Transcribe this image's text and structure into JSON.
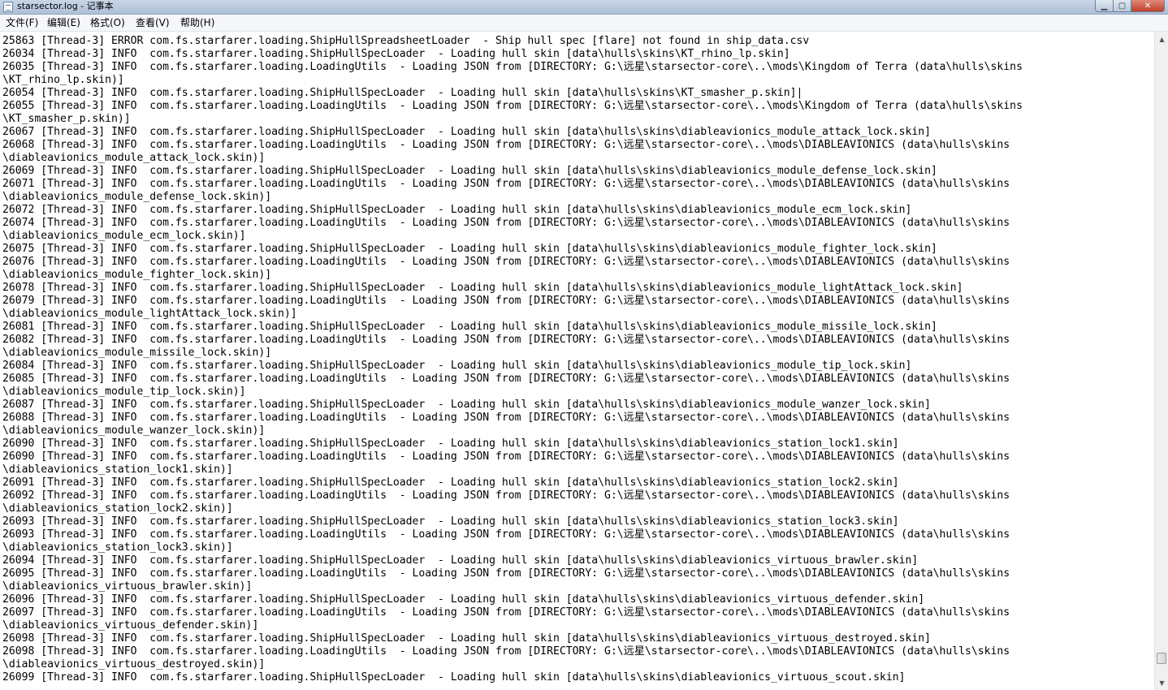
{
  "window": {
    "title": "starsector.log - 记事本",
    "controls": {
      "minimize": "▁",
      "maximize": "▢",
      "close": "✕"
    }
  },
  "menu": [
    "文件(F)",
    "编辑(E)",
    "格式(O)",
    "查看(V)",
    "帮助(H)"
  ],
  "scrollbar": {
    "position": 0.98,
    "up": "▲",
    "down": "▼"
  },
  "log_lines": [
    "25863 [Thread-3] ERROR com.fs.starfarer.loading.ShipHullSpreadsheetLoader  - Ship hull spec [flare] not found in ship_data.csv",
    "26034 [Thread-3] INFO  com.fs.starfarer.loading.ShipHullSpecLoader  - Loading hull skin [data\\hulls\\skins\\KT_rhino_lp.skin]",
    "26035 [Thread-3] INFO  com.fs.starfarer.loading.LoadingUtils  - Loading JSON from [DIRECTORY: G:\\远星\\starsector-core\\..\\mods\\Kingdom of Terra (data\\hulls\\skins",
    "\\KT_rhino_lp.skin)]",
    "26054 [Thread-3] INFO  com.fs.starfarer.loading.ShipHullSpecLoader  - Loading hull skin [data\\hulls\\skins\\KT_smasher_p.skin]|",
    "26055 [Thread-3] INFO  com.fs.starfarer.loading.LoadingUtils  - Loading JSON from [DIRECTORY: G:\\远星\\starsector-core\\..\\mods\\Kingdom of Terra (data\\hulls\\skins",
    "\\KT_smasher_p.skin)]",
    "26067 [Thread-3] INFO  com.fs.starfarer.loading.ShipHullSpecLoader  - Loading hull skin [data\\hulls\\skins\\diableavionics_module_attack_lock.skin]",
    "26068 [Thread-3] INFO  com.fs.starfarer.loading.LoadingUtils  - Loading JSON from [DIRECTORY: G:\\远星\\starsector-core\\..\\mods\\DIABLEAVIONICS (data\\hulls\\skins",
    "\\diableavionics_module_attack_lock.skin)]",
    "26069 [Thread-3] INFO  com.fs.starfarer.loading.ShipHullSpecLoader  - Loading hull skin [data\\hulls\\skins\\diableavionics_module_defense_lock.skin]",
    "26071 [Thread-3] INFO  com.fs.starfarer.loading.LoadingUtils  - Loading JSON from [DIRECTORY: G:\\远星\\starsector-core\\..\\mods\\DIABLEAVIONICS (data\\hulls\\skins",
    "\\diableavionics_module_defense_lock.skin)]",
    "26072 [Thread-3] INFO  com.fs.starfarer.loading.ShipHullSpecLoader  - Loading hull skin [data\\hulls\\skins\\diableavionics_module_ecm_lock.skin]",
    "26074 [Thread-3] INFO  com.fs.starfarer.loading.LoadingUtils  - Loading JSON from [DIRECTORY: G:\\远星\\starsector-core\\..\\mods\\DIABLEAVIONICS (data\\hulls\\skins",
    "\\diableavionics_module_ecm_lock.skin)]",
    "26075 [Thread-3] INFO  com.fs.starfarer.loading.ShipHullSpecLoader  - Loading hull skin [data\\hulls\\skins\\diableavionics_module_fighter_lock.skin]",
    "26076 [Thread-3] INFO  com.fs.starfarer.loading.LoadingUtils  - Loading JSON from [DIRECTORY: G:\\远星\\starsector-core\\..\\mods\\DIABLEAVIONICS (data\\hulls\\skins",
    "\\diableavionics_module_fighter_lock.skin)]",
    "26078 [Thread-3] INFO  com.fs.starfarer.loading.ShipHullSpecLoader  - Loading hull skin [data\\hulls\\skins\\diableavionics_module_lightAttack_lock.skin]",
    "26079 [Thread-3] INFO  com.fs.starfarer.loading.LoadingUtils  - Loading JSON from [DIRECTORY: G:\\远星\\starsector-core\\..\\mods\\DIABLEAVIONICS (data\\hulls\\skins",
    "\\diableavionics_module_lightAttack_lock.skin)]",
    "26081 [Thread-3] INFO  com.fs.starfarer.loading.ShipHullSpecLoader  - Loading hull skin [data\\hulls\\skins\\diableavionics_module_missile_lock.skin]",
    "26082 [Thread-3] INFO  com.fs.starfarer.loading.LoadingUtils  - Loading JSON from [DIRECTORY: G:\\远星\\starsector-core\\..\\mods\\DIABLEAVIONICS (data\\hulls\\skins",
    "\\diableavionics_module_missile_lock.skin)]",
    "26084 [Thread-3] INFO  com.fs.starfarer.loading.ShipHullSpecLoader  - Loading hull skin [data\\hulls\\skins\\diableavionics_module_tip_lock.skin]",
    "26085 [Thread-3] INFO  com.fs.starfarer.loading.LoadingUtils  - Loading JSON from [DIRECTORY: G:\\远星\\starsector-core\\..\\mods\\DIABLEAVIONICS (data\\hulls\\skins",
    "\\diableavionics_module_tip_lock.skin)]",
    "26087 [Thread-3] INFO  com.fs.starfarer.loading.ShipHullSpecLoader  - Loading hull skin [data\\hulls\\skins\\diableavionics_module_wanzer_lock.skin]",
    "26088 [Thread-3] INFO  com.fs.starfarer.loading.LoadingUtils  - Loading JSON from [DIRECTORY: G:\\远星\\starsector-core\\..\\mods\\DIABLEAVIONICS (data\\hulls\\skins",
    "\\diableavionics_module_wanzer_lock.skin)]",
    "26090 [Thread-3] INFO  com.fs.starfarer.loading.ShipHullSpecLoader  - Loading hull skin [data\\hulls\\skins\\diableavionics_station_lock1.skin]",
    "26090 [Thread-3] INFO  com.fs.starfarer.loading.LoadingUtils  - Loading JSON from [DIRECTORY: G:\\远星\\starsector-core\\..\\mods\\DIABLEAVIONICS (data\\hulls\\skins",
    "\\diableavionics_station_lock1.skin)]",
    "26091 [Thread-3] INFO  com.fs.starfarer.loading.ShipHullSpecLoader  - Loading hull skin [data\\hulls\\skins\\diableavionics_station_lock2.skin]",
    "26092 [Thread-3] INFO  com.fs.starfarer.loading.LoadingUtils  - Loading JSON from [DIRECTORY: G:\\远星\\starsector-core\\..\\mods\\DIABLEAVIONICS (data\\hulls\\skins",
    "\\diableavionics_station_lock2.skin)]",
    "26093 [Thread-3] INFO  com.fs.starfarer.loading.ShipHullSpecLoader  - Loading hull skin [data\\hulls\\skins\\diableavionics_station_lock3.skin]",
    "26093 [Thread-3] INFO  com.fs.starfarer.loading.LoadingUtils  - Loading JSON from [DIRECTORY: G:\\远星\\starsector-core\\..\\mods\\DIABLEAVIONICS (data\\hulls\\skins",
    "\\diableavionics_station_lock3.skin)]",
    "26094 [Thread-3] INFO  com.fs.starfarer.loading.ShipHullSpecLoader  - Loading hull skin [data\\hulls\\skins\\diableavionics_virtuous_brawler.skin]",
    "26095 [Thread-3] INFO  com.fs.starfarer.loading.LoadingUtils  - Loading JSON from [DIRECTORY: G:\\远星\\starsector-core\\..\\mods\\DIABLEAVIONICS (data\\hulls\\skins",
    "\\diableavionics_virtuous_brawler.skin)]",
    "26096 [Thread-3] INFO  com.fs.starfarer.loading.ShipHullSpecLoader  - Loading hull skin [data\\hulls\\skins\\diableavionics_virtuous_defender.skin]",
    "26097 [Thread-3] INFO  com.fs.starfarer.loading.LoadingUtils  - Loading JSON from [DIRECTORY: G:\\远星\\starsector-core\\..\\mods\\DIABLEAVIONICS (data\\hulls\\skins",
    "\\diableavionics_virtuous_defender.skin)]",
    "26098 [Thread-3] INFO  com.fs.starfarer.loading.ShipHullSpecLoader  - Loading hull skin [data\\hulls\\skins\\diableavionics_virtuous_destroyed.skin]",
    "26098 [Thread-3] INFO  com.fs.starfarer.loading.LoadingUtils  - Loading JSON from [DIRECTORY: G:\\远星\\starsector-core\\..\\mods\\DIABLEAVIONICS (data\\hulls\\skins",
    "\\diableavionics_virtuous_destroyed.skin)]",
    "26099 [Thread-3] INFO  com.fs.starfarer.loading.ShipHullSpecLoader  - Loading hull skin [data\\hulls\\skins\\diableavionics_virtuous_scout.skin]"
  ]
}
